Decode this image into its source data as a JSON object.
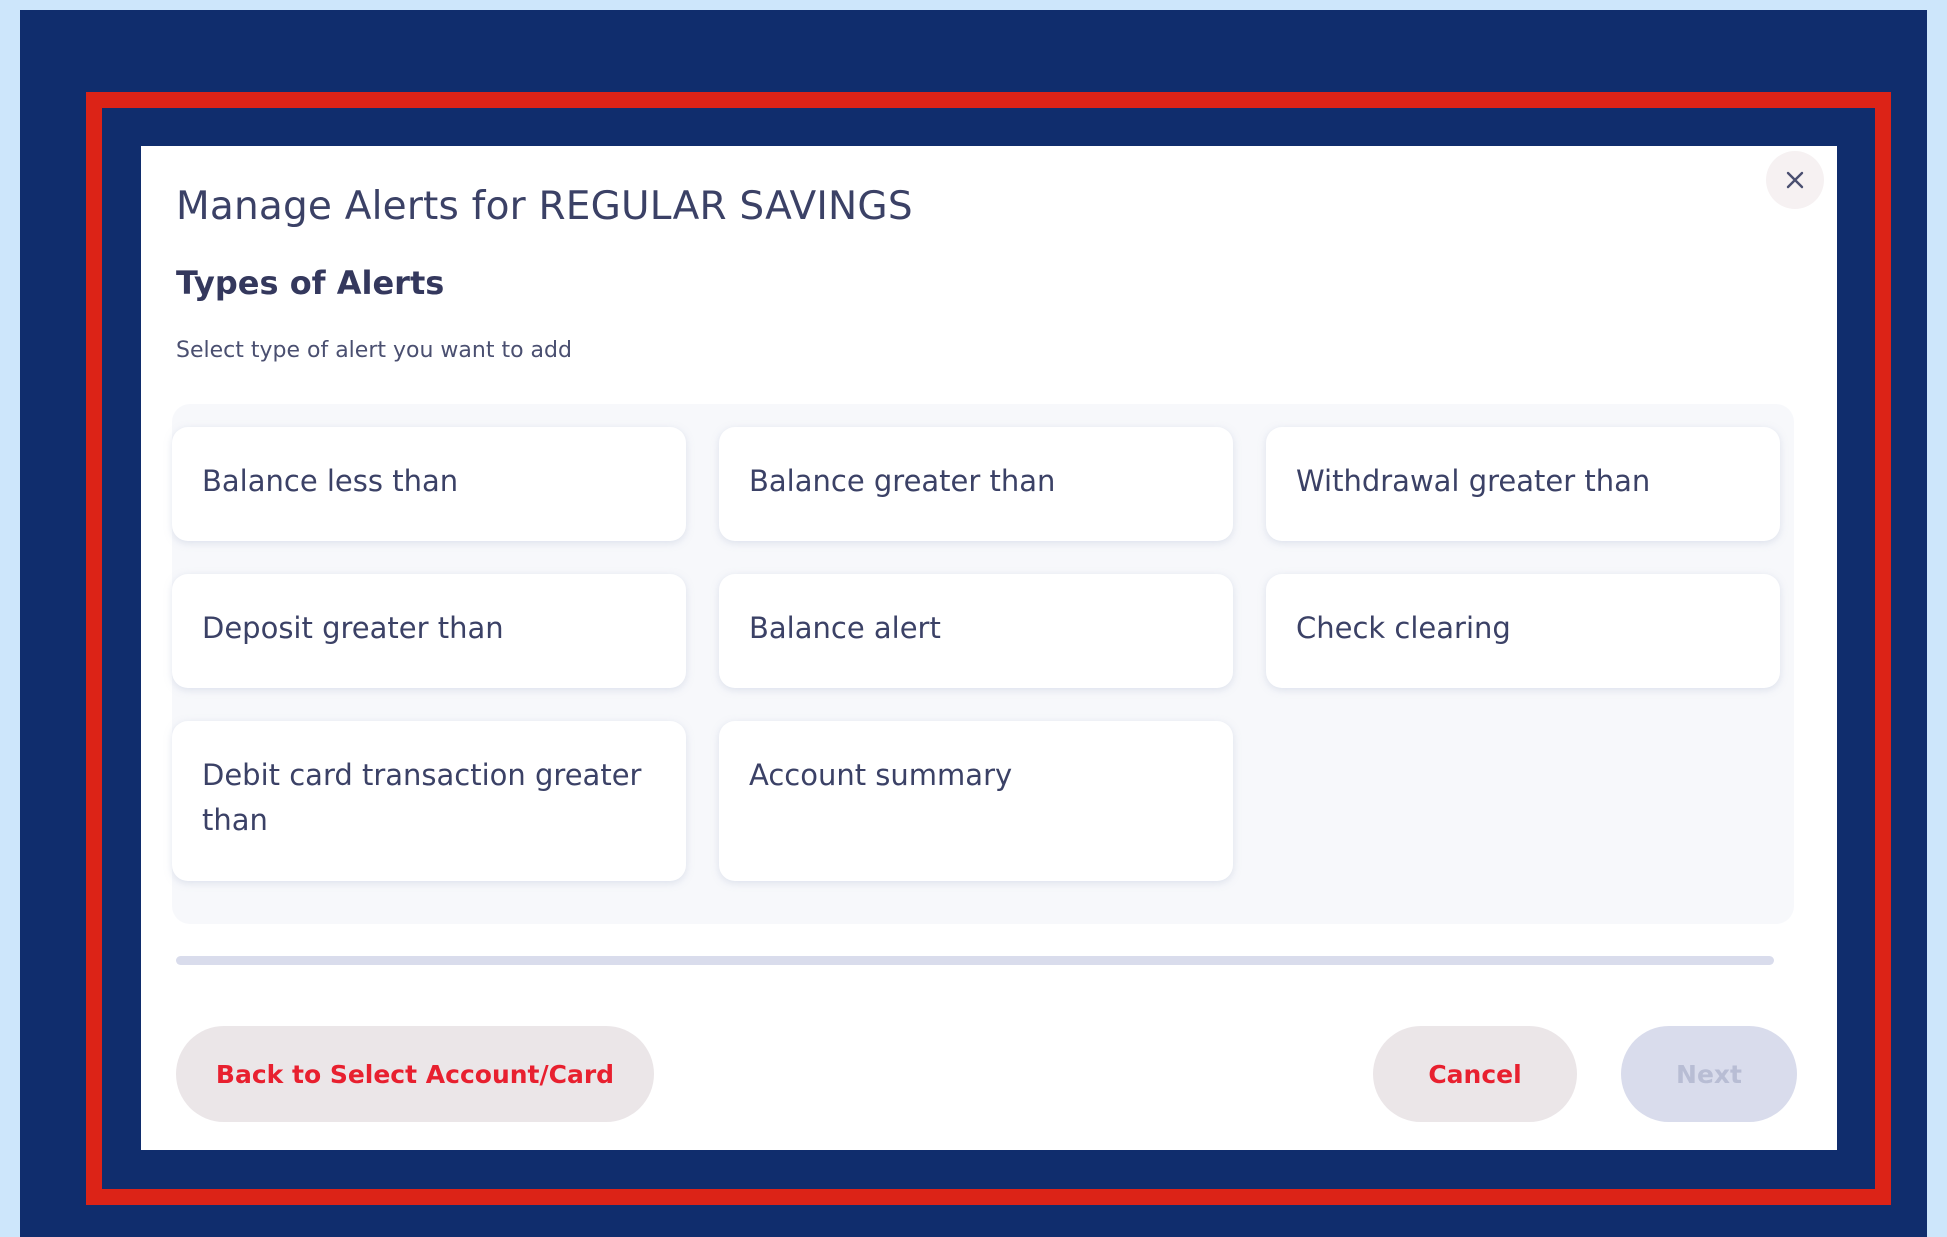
{
  "modal": {
    "title": "Manage Alerts for REGULAR SAVINGS",
    "section_heading": "Types of Alerts",
    "section_subtitle": "Select type of alert you want to add",
    "close_icon": "close-icon"
  },
  "alert_types": [
    "Balance less than",
    "Balance greater than",
    "Withdrawal greater than",
    "Deposit greater than",
    "Balance alert",
    "Check clearing",
    "Debit card transaction greater than",
    "Account summary"
  ],
  "footer": {
    "back_label": "Back to Select Account/Card",
    "cancel_label": "Cancel",
    "next_label": "Next"
  },
  "colors": {
    "navy_frame": "#102d6d",
    "red_frame": "#dc2317",
    "outer_bg": "#cde6fb",
    "action_red": "#e8202f",
    "disabled": "#d9dcec"
  }
}
